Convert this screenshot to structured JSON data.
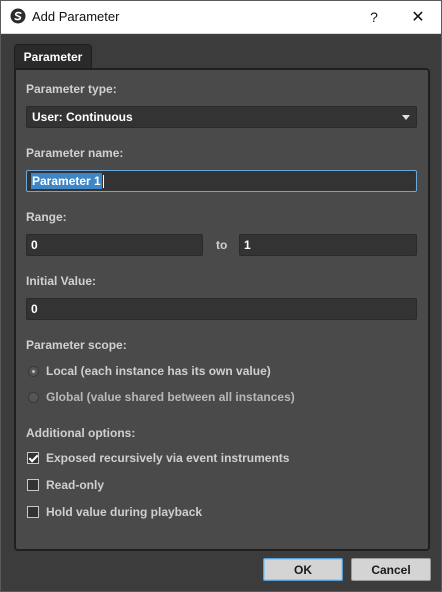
{
  "window": {
    "title": "Add Parameter",
    "help_glyph": "?",
    "close_glyph": "✕",
    "app_icon": "studio-logo-icon"
  },
  "tabs": [
    {
      "label": "Parameter",
      "active": true
    }
  ],
  "form": {
    "parameter_type": {
      "label": "Parameter type:",
      "value": "User: Continuous"
    },
    "parameter_name": {
      "label": "Parameter name:",
      "value": "Parameter 1"
    },
    "range": {
      "label": "Range:",
      "min": "0",
      "to_label": "to",
      "max": "1"
    },
    "initial_value": {
      "label": "Initial Value:",
      "value": "0"
    },
    "scope": {
      "label": "Parameter scope:",
      "options": [
        {
          "label": "Local (each instance has its own value)",
          "checked": true
        },
        {
          "label": "Global (value shared between all instances)",
          "checked": false
        }
      ]
    },
    "additional": {
      "label": "Additional options:",
      "options": [
        {
          "label": "Exposed recursively via event instruments",
          "checked": true
        },
        {
          "label": "Read-only",
          "checked": false
        },
        {
          "label": "Hold value during playback",
          "checked": false
        }
      ]
    }
  },
  "buttons": {
    "ok": "OK",
    "cancel": "Cancel"
  },
  "colors": {
    "panel": "#4a4a4a",
    "field": "#333333",
    "selection": "#3e86c6",
    "focus_border": "#6aa8d8"
  }
}
